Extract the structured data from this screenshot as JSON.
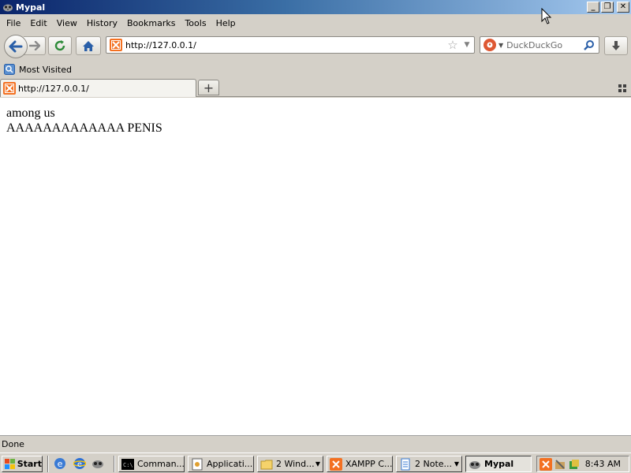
{
  "window": {
    "title": "Mypal",
    "minimize": "_",
    "restore": "❐",
    "close": "✕"
  },
  "menu": [
    "File",
    "Edit",
    "View",
    "History",
    "Bookmarks",
    "Tools",
    "Help"
  ],
  "navbar": {
    "url": "http://127.0.0.1/",
    "search_placeholder": "DuckDuckGo"
  },
  "bookmarks": {
    "most_visited": "Most Visited"
  },
  "tab": {
    "title": "http://127.0.0.1/",
    "new_tab": "+"
  },
  "page": {
    "line1": "among us",
    "line2": "AAAAAAAAAAAAA PENIS"
  },
  "status": "Done",
  "taskbar": {
    "start": "Start",
    "tasks": [
      {
        "label": "Comman...",
        "icon": "cmd-icon"
      },
      {
        "label": "Applicati...",
        "icon": "application-icon"
      },
      {
        "label": "2 Wind...",
        "icon": "folder-icon",
        "group": true
      },
      {
        "label": "XAMPP C...",
        "icon": "xampp-icon"
      },
      {
        "label": "2 Note...",
        "icon": "notepad-icon",
        "group": true
      },
      {
        "label": "Mypal",
        "icon": "mypal-icon",
        "active": true
      }
    ],
    "clock": "8:43 AM"
  },
  "colors": {
    "titlebar_start": "#0a246a",
    "titlebar_end": "#a6caf0",
    "xampp_orange": "#f37021",
    "duckduckgo": "#de5833",
    "chrome_gray": "#d4d0c8"
  }
}
